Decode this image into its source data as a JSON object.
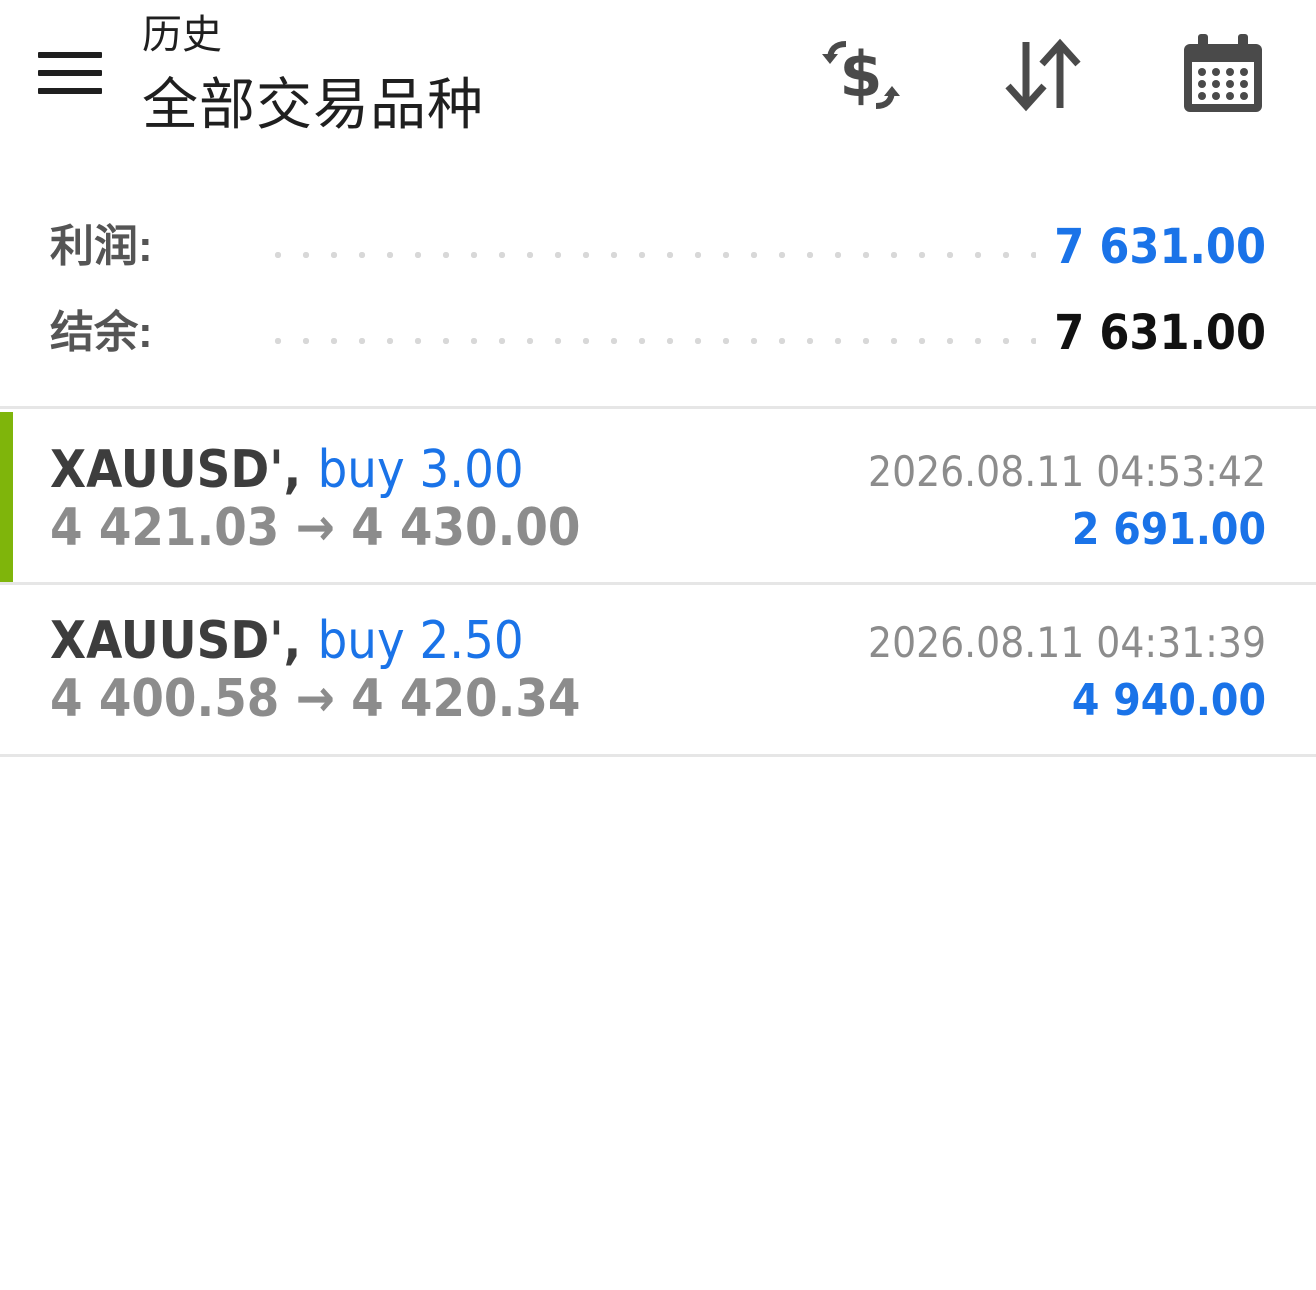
{
  "header": {
    "title_small": "历史",
    "title_big": "全部交易品种",
    "icons": [
      "menu-icon",
      "dollar-exchange-icon",
      "sort-icon",
      "calendar-icon"
    ]
  },
  "summary": {
    "profit_label": "利润:",
    "profit_value": "7 631.00",
    "balance_label": "结余:",
    "balance_value": "7 631.00"
  },
  "trades": [
    {
      "symbol": "XAUUSD',",
      "side": "buy 3.00",
      "prices": "4 421.03 → 4 430.00",
      "time": "2026.08.11 04:53:42",
      "profit": "2 691.00"
    },
    {
      "symbol": "XAUUSD',",
      "side": "buy 2.50",
      "prices": "4 400.58 → 4 420.34",
      "time": "2026.08.11 04:31:39",
      "profit": "4 940.00"
    }
  ],
  "colors": {
    "accent_blue": "#1a73e8",
    "selected_bar": "#7fb50b",
    "muted_text": "#8c8c8c"
  }
}
